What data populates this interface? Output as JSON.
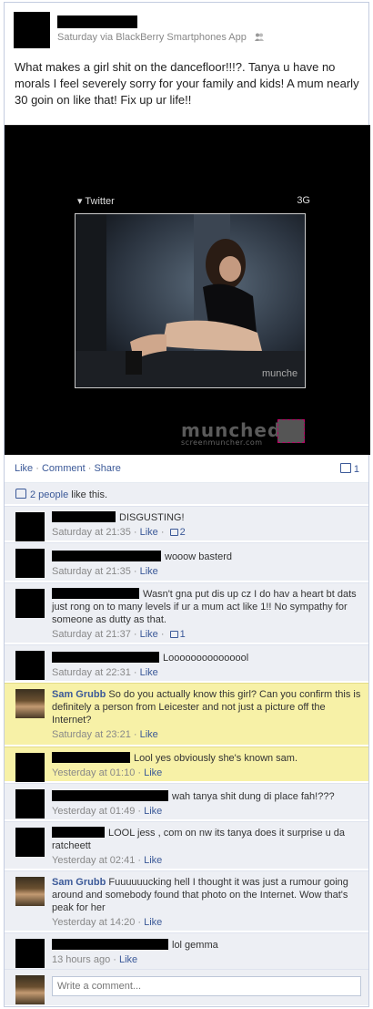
{
  "post": {
    "meta": "Saturday via BlackBerry Smartphones App",
    "text": "What makes a girl shit on the dancefloor!!!?. Tanya u have no morals I feel severely sorry for your family and kids! A mum nearly 30 goin on like that! Fix up ur life!!"
  },
  "media": {
    "phone_app": "Twitter",
    "phone_signal": "3G",
    "watermark_main": "munched",
    "watermark_sub": "screenmuncher.com"
  },
  "actions": {
    "like": "Like",
    "comment": "Comment",
    "share": "Share",
    "comment_count": "1"
  },
  "likes": {
    "people": "2 people",
    "suffix": " like this."
  },
  "comments": [
    {
      "name": "",
      "text": "DISGUSTING!",
      "time": "Saturday at 21:35",
      "like": "Like",
      "likes": "2"
    },
    {
      "name": "",
      "text": "wooow basterd",
      "time": "Saturday at 21:35",
      "like": "Like"
    },
    {
      "name": "",
      "text": "Wasn't gna put dis up cz I do hav a heart bt dats just rong on to many levels if ur a mum act like 1!! No sympathy for someone as dutty as that.",
      "time": "Saturday at 21:37",
      "like": "Like",
      "likes": "1"
    },
    {
      "name": "",
      "text": "Looooooooooooool",
      "time": "Saturday at 22:31",
      "like": "Like"
    },
    {
      "name": "Sam Grubb",
      "text": "So do you actually know this girl? Can you confirm this is definitely a person from Leicester and not just a picture off the Internet?",
      "time": "Saturday at 23:21",
      "like": "Like"
    },
    {
      "name": "",
      "text": "Lool yes obviously she's known sam.",
      "time": "Yesterday at 01:10",
      "like": "Like"
    },
    {
      "name": "",
      "text": "wah tanya shit dung di place fah!???",
      "time": "Yesterday at 01:49",
      "like": "Like"
    },
    {
      "name": "",
      "text": "LOOL jess , com on nw its tanya does it surprise u da ratcheett",
      "time": "Yesterday at 02:41",
      "like": "Like"
    },
    {
      "name": "Sam Grubb",
      "text": "Fuuuuuucking hell I thought it was just a rumour going around and somebody found that photo on the Internet. Wow that's peak for her",
      "time": "Yesterday at 14:20",
      "like": "Like"
    },
    {
      "name": "",
      "text": "lol gemma",
      "time": "13 hours ago",
      "like": "Like"
    }
  ],
  "write_comment": {
    "placeholder": "Write a comment..."
  },
  "colors": {
    "link": "#3b5998",
    "comment_bg": "#edeff4",
    "highlight_bg": "#f7f1a7"
  }
}
